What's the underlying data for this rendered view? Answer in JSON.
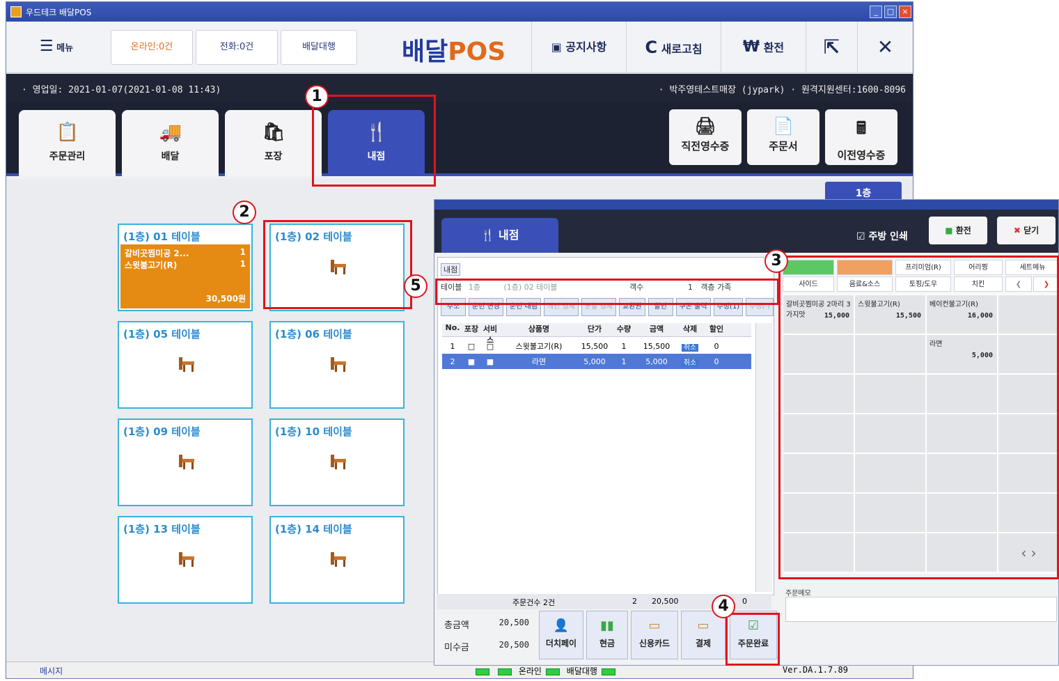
{
  "main_window": {
    "title": "우드테크 배달POS",
    "toolbar": {
      "menu_label": "메뉴",
      "online_label": "온라인:0건",
      "phone_label": "전화:0건",
      "delivery_agency_label": "배달대행",
      "brand_prefix": "배달",
      "brand_suffix": "POS",
      "notice_label": "공지사항",
      "refresh_label": "새로고침",
      "exchange_label": "환전"
    },
    "info_left": "· 영업일: 2021-01-07(2021-01-08 11:43)",
    "info_right": "· 박주영테스트매장 (jypark)  · 원격지원센터:1600-8096",
    "tabs": [
      {
        "label": "주문관리",
        "icon": "clipboard-icon"
      },
      {
        "label": "배달",
        "icon": "truck-icon"
      },
      {
        "label": "포장",
        "icon": "bag-icon"
      },
      {
        "label": "내점",
        "icon": "cutlery-icon"
      }
    ],
    "right_buttons": [
      {
        "label": "직전영수증",
        "icon": "printer-icon"
      },
      {
        "label": "주문서",
        "icon": "document-icon"
      },
      {
        "label": "이전영수증",
        "icon": "calculator-icon"
      }
    ],
    "floor_tag": "1층",
    "tables": [
      {
        "name": "(1층) 01 테이블",
        "items": [
          {
            "name": "갈비곳찜미공 2...",
            "qty": "1"
          },
          {
            "name": "스윗불고기(R)",
            "qty": "1"
          }
        ],
        "total": "30,500원"
      },
      {
        "name": "(1층) 02 테이블"
      },
      {
        "name": "(1층) 05 테이블"
      },
      {
        "name": "(1층) 06 테이블"
      },
      {
        "name": "(1층) 09 테이블"
      },
      {
        "name": "(1층) 10 테이블"
      },
      {
        "name": "(1층) 13 테이블"
      },
      {
        "name": "(1층) 14 테이블"
      }
    ],
    "status": {
      "message": "메시지",
      "online": "온라인",
      "delivery": "배달대행",
      "version": "Ver.DA.1.7.89"
    }
  },
  "dialog": {
    "tab_label": "내점",
    "kitchen_print": "주방 인쇄",
    "exchange_label": "환전",
    "close_label": "닫기",
    "order_tag": "내점",
    "table_label": "테이블",
    "table_value": "1층",
    "table_name": "(1층) 02 테이블",
    "guests_label": "객수",
    "guests_value": "1",
    "guest_type_label": "객층",
    "guest_type_value": "가족",
    "actions": [
      "주소",
      "순번 변경",
      "순번 내림",
      "개인 결제",
      "분할 결제",
      "교환권",
      "할인",
      "쿠폰 출력",
      "수정(1)",
      "수정(-)"
    ],
    "columns": [
      "No.",
      "포장",
      "서비스",
      "상품명",
      "단가",
      "수량",
      "금액",
      "삭제",
      "할인"
    ],
    "rows": [
      {
        "no": "1",
        "name": "스윗불고기(R)",
        "price": "15,500",
        "qty": "1",
        "amount": "15,500",
        "delete": "취소",
        "discount": "0"
      },
      {
        "no": "2",
        "name": "라면",
        "price": "5,000",
        "qty": "1",
        "amount": "5,000",
        "delete": "취소",
        "discount": "0"
      }
    ],
    "summary": {
      "label": "주문건수 2건",
      "qty": "2",
      "amount": "20,500",
      "discount": "0"
    },
    "payment": {
      "total_label": "총금액",
      "total_value": "20,500",
      "unpaid_label": "미수금",
      "unpaid_value": "20,500",
      "buttons": [
        "더치페이",
        "현금",
        "신용카드",
        "결제",
        "주문완료"
      ]
    },
    "categories_row1": [
      "",
      "",
      "프리미엄(R)",
      "어리찡",
      "세트메뉴"
    ],
    "categories_row2": [
      "사이드",
      "음료&소스",
      "토핑/도우",
      "치킨"
    ],
    "menu_items": [
      {
        "name": "갈비곳찜미공 2마리 3가지맛",
        "price": "15,000"
      },
      {
        "name": "스윗불고기(R)",
        "price": "15,500"
      },
      {
        "name": "베이컨불고기(R)",
        "price": "16,000"
      },
      {
        "name": "",
        "price": ""
      },
      {
        "name": "",
        "price": ""
      },
      {
        "name": "",
        "price": ""
      },
      {
        "name": "라면",
        "price": "5,000"
      }
    ],
    "memo_label": "주문메모"
  },
  "annotations": [
    "1",
    "2",
    "3",
    "4",
    "5"
  ]
}
